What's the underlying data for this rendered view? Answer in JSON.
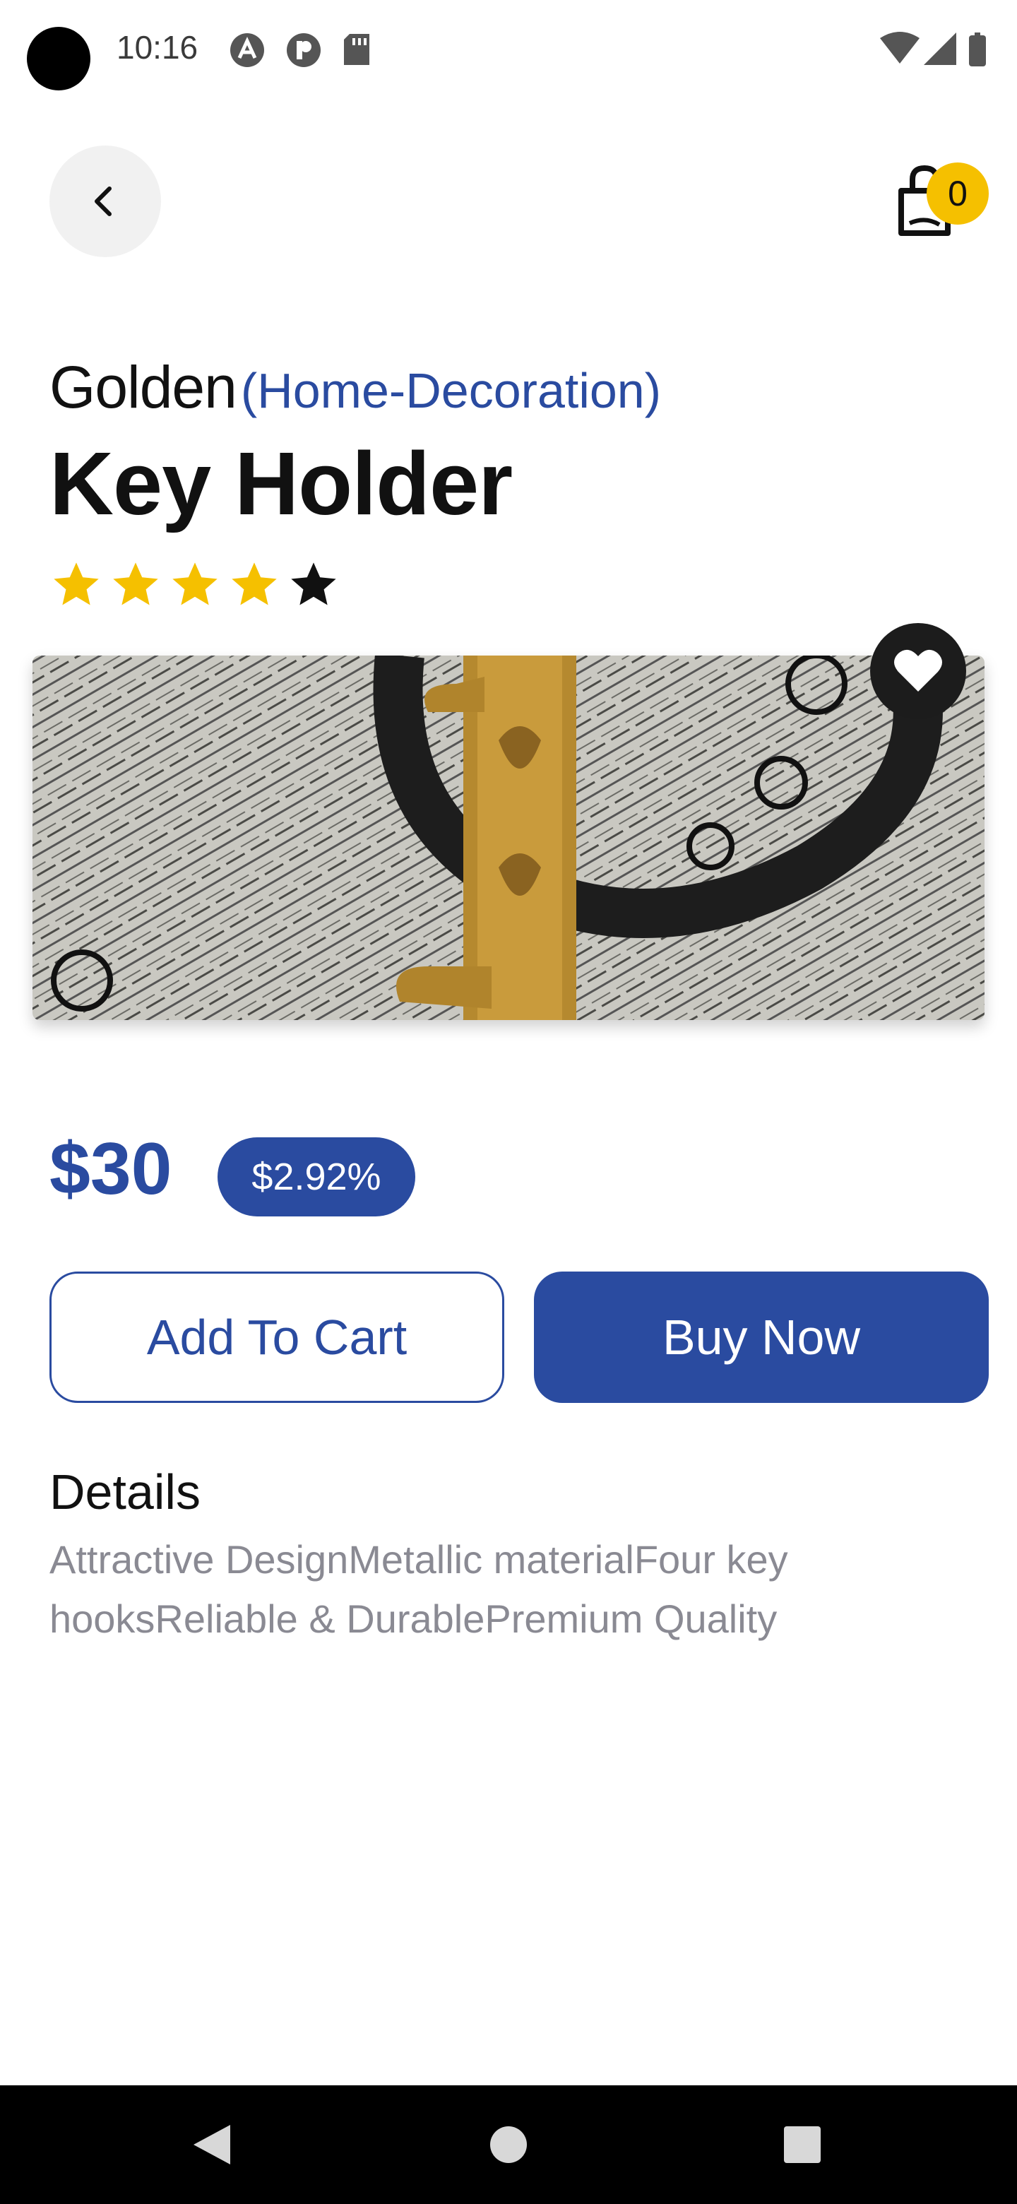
{
  "status_bar": {
    "time": "10:16",
    "left_icons": [
      "autofill-icon",
      "p-app-icon",
      "sd-card-icon"
    ],
    "right_icons": [
      "wifi-icon",
      "signal-icon",
      "battery-icon"
    ]
  },
  "header": {
    "back_icon": "chevron-left-icon",
    "cart_icon": "shopping-bag-icon",
    "cart_count": "0"
  },
  "product": {
    "brand": "Golden",
    "category": "(Home-Decoration)",
    "title": "Key Holder",
    "rating": 4,
    "rating_max": 5,
    "price": "$30",
    "discount": "$2.92%",
    "image": "key holder on printed fabric"
  },
  "actions": {
    "add_to_cart": "Add To Cart",
    "buy_now": "Buy Now"
  },
  "details": {
    "heading": "Details",
    "text": "Attractive DesignMetallic materialFour key hooksReliable & DurablePremium Quality"
  },
  "colors": {
    "accent": "#2a4ba0",
    "star": "#f5c000",
    "badge": "#f5c000"
  }
}
